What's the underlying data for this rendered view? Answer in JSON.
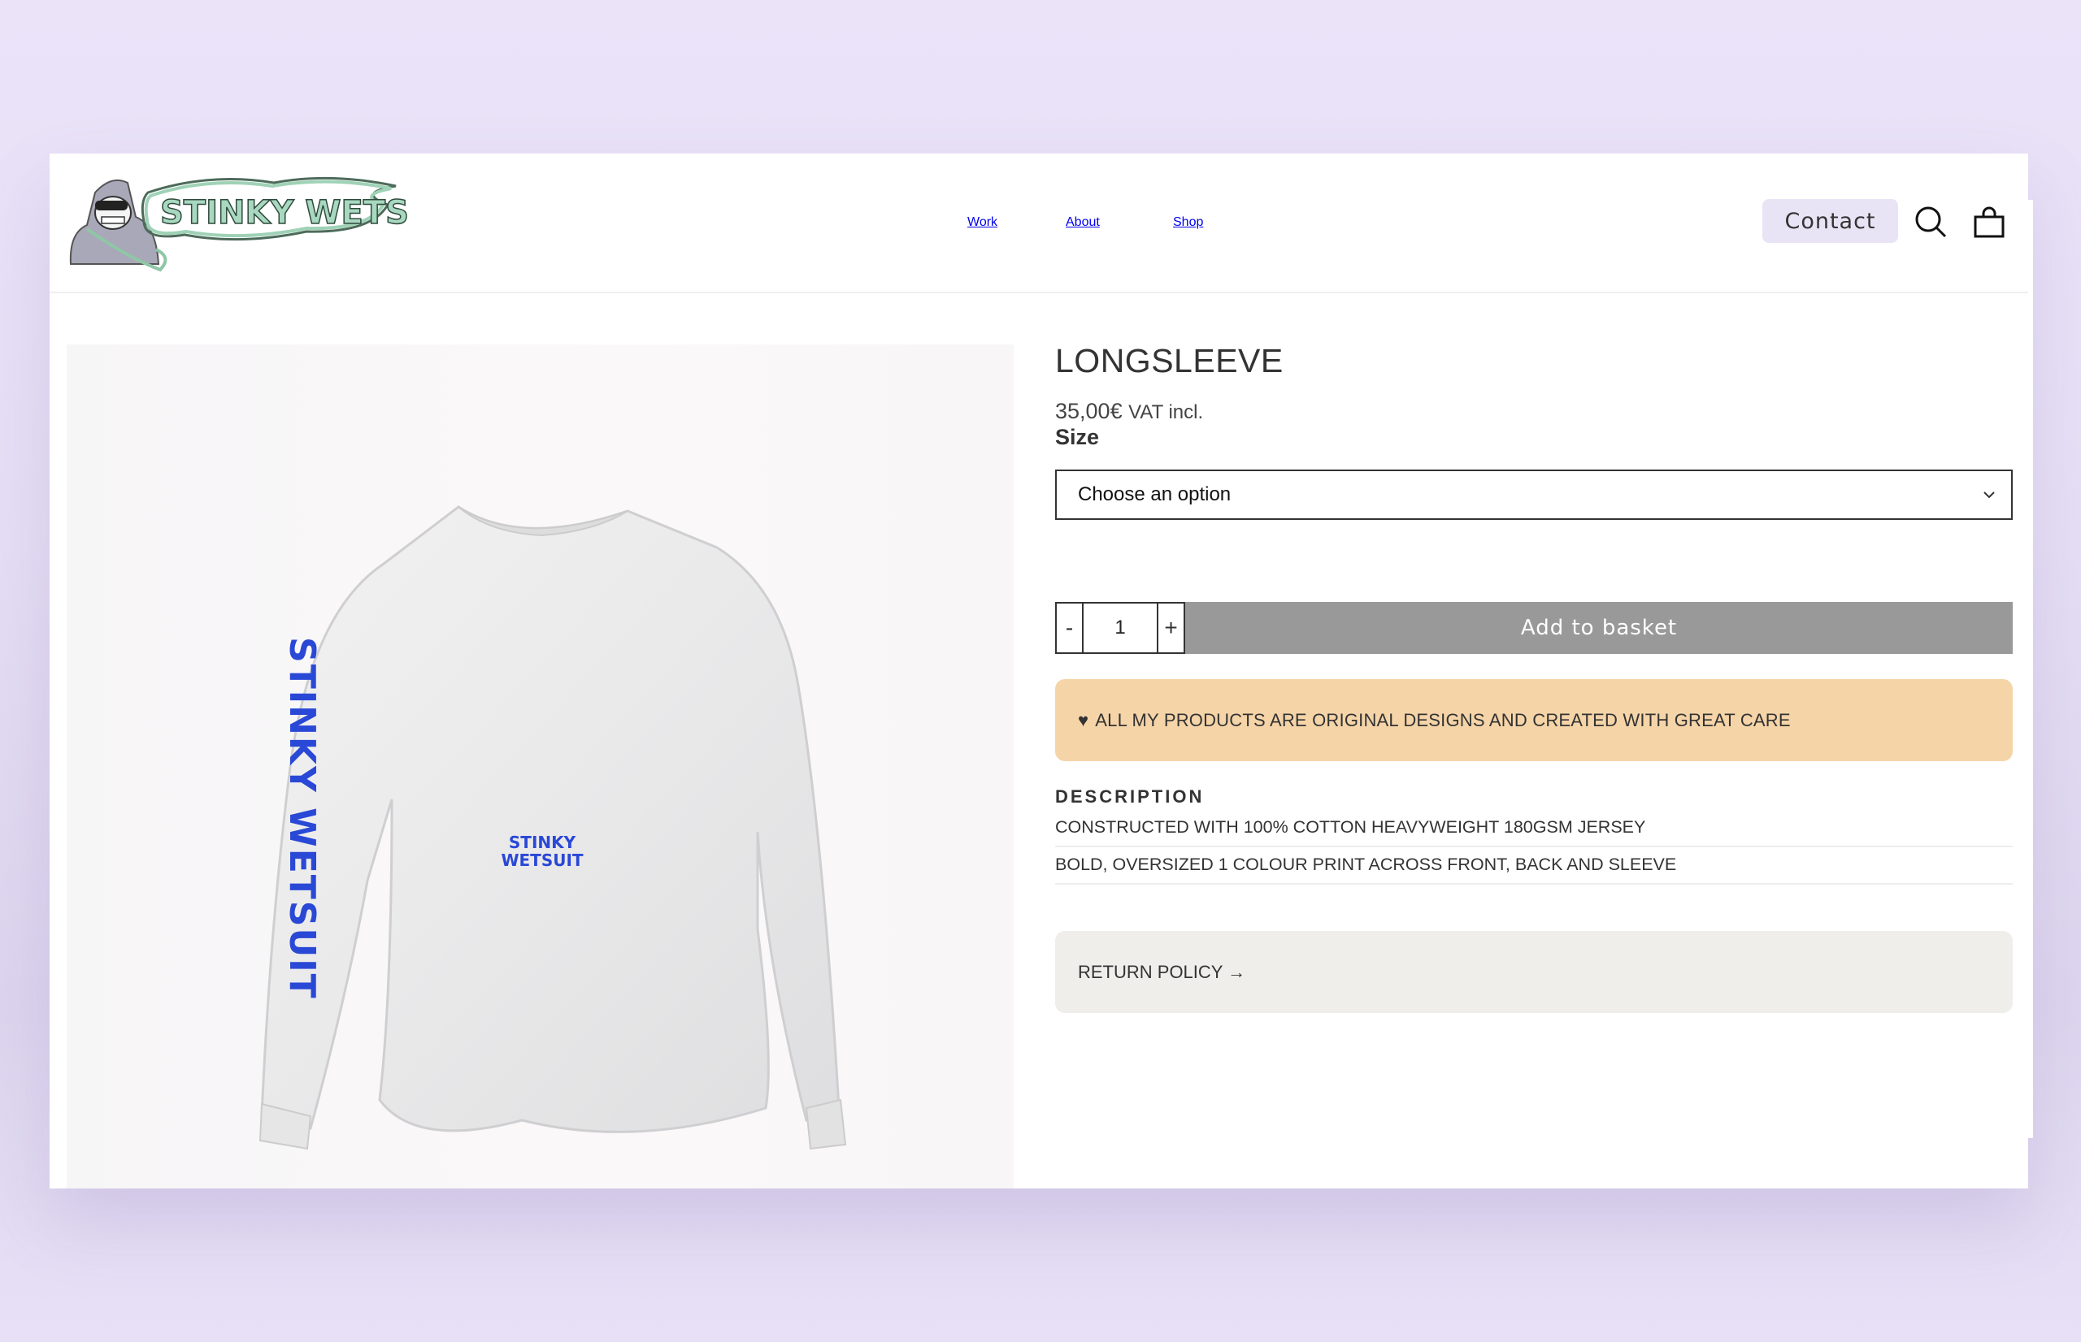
{
  "brand": {
    "name": "STINKY WETSUIT",
    "logo_icon": "stinky-wetsuit-logo"
  },
  "nav": {
    "items": [
      {
        "label": "Work"
      },
      {
        "label": "About"
      },
      {
        "label": "Shop"
      }
    ]
  },
  "header_actions": {
    "contact_label": "Contact",
    "search_icon": "search-icon",
    "basket_icon": "shopping-bag-icon"
  },
  "product": {
    "title": "LONGSLEEVE",
    "price": "35,00€",
    "price_suffix": "VAT incl.",
    "size_label": "Size",
    "size_select": {
      "selected": "Choose an option"
    },
    "quantity": {
      "value": "1",
      "minus": "-",
      "plus": "+"
    },
    "add_to_basket_label": "Add to basket",
    "notice": {
      "icon": "♥",
      "text": "ALL MY PRODUCTS ARE ORIGINAL DESIGNS AND CREATED WITH GREAT CARE"
    },
    "description": {
      "heading": "DESCRIPTION",
      "items": [
        "CONSTRUCTED WITH 100% COTTON HEAVYWEIGHT 180GSM JERSEY",
        "BOLD, OVERSIZED 1 COLOUR PRINT ACROSS FRONT, BACK AND SLEEVE"
      ]
    },
    "return_policy_label": "RETURN POLICY →",
    "image": {
      "alt": "White longsleeve t-shirt",
      "chest_print": [
        "STINKY",
        "WETSUIT"
      ],
      "sleeve_print": "STINKY WETSUIT",
      "print_color": "#2a48d6"
    }
  },
  "colors": {
    "background": "#e9e2f7",
    "contact_bg": "#e9e4f5",
    "notice_bg": "#f5d4a8",
    "return_bg": "#efeeeb",
    "button_disabled": "#999999"
  }
}
